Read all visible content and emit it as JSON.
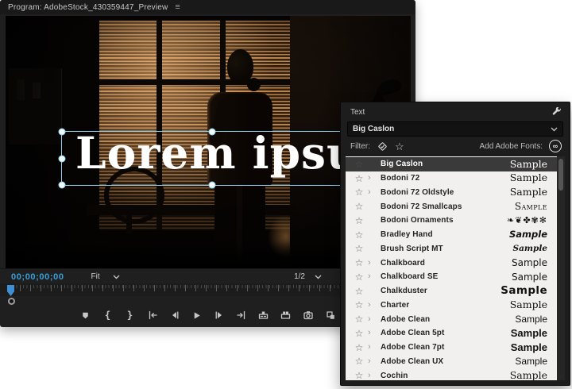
{
  "colors": {
    "accent_blue": "#3aa0dc",
    "selection_blue": "#8ed2f0",
    "playhead_blue": "#3f8fd6",
    "panel_chrome": "#1d1d1d",
    "font_list_bg": "#f1f0ef",
    "selected_row_bg": "#3a3a3a"
  },
  "program_monitor": {
    "title": "Program: AdobeStock_430359447_Preview",
    "menu_icon": "panel-menu-icon",
    "overlay_text": "Lorem ipsum",
    "timecode": "00;00;00;00",
    "zoom_select": "Fit",
    "resolution_select": "1/2",
    "transport": [
      "add-marker-button",
      "mark-in-button",
      "mark-out-button",
      "go-to-in-button",
      "step-back-button",
      "play-button",
      "step-forward-button",
      "go-to-out-button",
      "lift-button",
      "extract-button",
      "export-frame-button",
      "comparison-view-button"
    ]
  },
  "text_panel": {
    "title": "Text",
    "font_select": "Big Caslon",
    "filter_label": "Filter:",
    "add_fonts_label": "Add Adobe Fonts:",
    "fonts": [
      {
        "name": "Big Caslon",
        "expandable": false,
        "selected": true,
        "sample": "Sample",
        "style": "serif"
      },
      {
        "name": "Bodoni 72",
        "expandable": true,
        "selected": false,
        "sample": "Sample",
        "style": "serif"
      },
      {
        "name": "Bodoni 72 Oldstyle",
        "expandable": true,
        "selected": false,
        "sample": "Sample",
        "style": "serif"
      },
      {
        "name": "Bodoni 72 Smallcaps",
        "expandable": false,
        "selected": false,
        "sample": "Sample",
        "style": "smallcaps"
      },
      {
        "name": "Bodoni Ornaments",
        "expandable": false,
        "selected": false,
        "sample": "❧❦✤✾✻",
        "style": "ornaments"
      },
      {
        "name": "Bradley Hand",
        "expandable": false,
        "selected": false,
        "sample": "Sample",
        "style": "hand"
      },
      {
        "name": "Brush Script MT",
        "expandable": false,
        "selected": false,
        "sample": "Sample",
        "style": "script"
      },
      {
        "name": "Chalkboard",
        "expandable": true,
        "selected": false,
        "sample": "Sample",
        "style": "rounded"
      },
      {
        "name": "Chalkboard SE",
        "expandable": true,
        "selected": false,
        "sample": "Sample",
        "style": "rounded"
      },
      {
        "name": "Chalkduster",
        "expandable": false,
        "selected": false,
        "sample": "Sample",
        "style": "chalk"
      },
      {
        "name": "Charter",
        "expandable": true,
        "selected": false,
        "sample": "Sample",
        "style": "serif"
      },
      {
        "name": "Adobe Clean",
        "expandable": true,
        "selected": false,
        "sample": "Sample",
        "style": "sans"
      },
      {
        "name": "Adobe Clean 5pt",
        "expandable": true,
        "selected": false,
        "sample": "Sample",
        "style": "sansbold"
      },
      {
        "name": "Adobe Clean 7pt",
        "expandable": true,
        "selected": false,
        "sample": "Sample",
        "style": "sansbold"
      },
      {
        "name": "Adobe Clean UX",
        "expandable": true,
        "selected": false,
        "sample": "Sample",
        "style": "sans"
      },
      {
        "name": "Cochin",
        "expandable": true,
        "selected": false,
        "sample": "Sample",
        "style": "serif"
      }
    ]
  }
}
